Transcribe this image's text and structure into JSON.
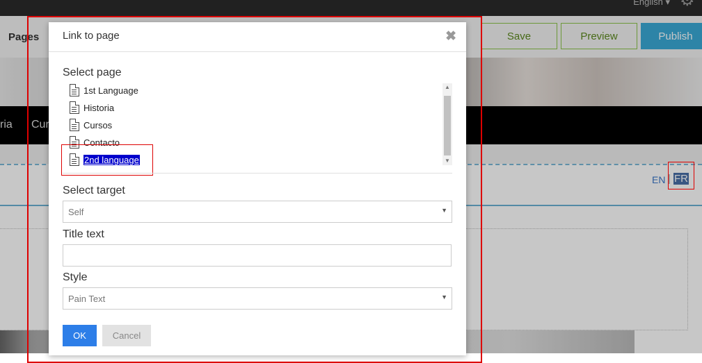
{
  "app": {
    "language_menu": "English ▾",
    "pages_title": "Pages",
    "save_label": "Save",
    "preview_label": "Preview",
    "publish_label": "Publish",
    "nav_items": [
      "ria",
      "Cur"
    ],
    "lang_en": "EN",
    "lang_sep": "|",
    "lang_fr": "FR"
  },
  "modal": {
    "title": "Link to page",
    "close_glyph": "✖",
    "select_page_label": "Select page",
    "pages": [
      {
        "label": "1st Language"
      },
      {
        "label": "Historia"
      },
      {
        "label": "Cursos"
      },
      {
        "label": "Contacto"
      },
      {
        "label": "2nd language",
        "selected": true
      }
    ],
    "select_target_label": "Select target",
    "target_value": "Self",
    "title_text_label": "Title text",
    "title_text_value": "",
    "style_label": "Style",
    "style_value": "Pain Text",
    "ok_label": "OK",
    "cancel_label": "Cancel"
  },
  "colors": {
    "annotation": "#dd0000",
    "primary": "#2d7ee8",
    "publish": "#3aa9d6",
    "save_border": "#8bc34a"
  }
}
